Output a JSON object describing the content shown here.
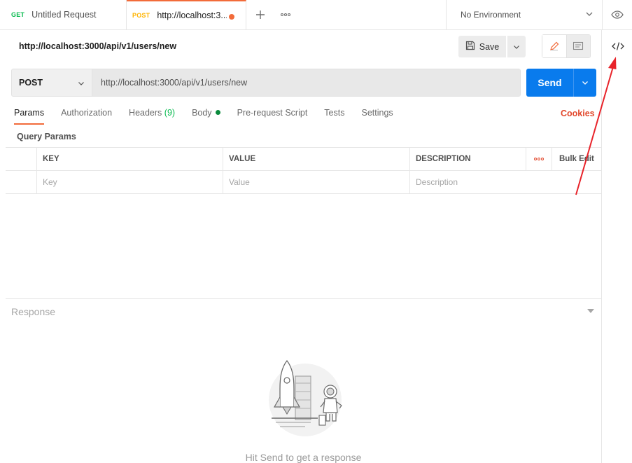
{
  "tabs": [
    {
      "method": "GET",
      "title": "Untitled Request"
    },
    {
      "method": "POST",
      "title": "http://localhost:3..."
    }
  ],
  "environment": {
    "selected": "No Environment"
  },
  "request": {
    "name": "http://localhost:3000/api/v1/users/new",
    "save_label": "Save",
    "method": "POST",
    "url": "http://localhost:3000/api/v1/users/new",
    "send_label": "Send"
  },
  "request_tabs": {
    "params": "Params",
    "authorization": "Authorization",
    "headers": "Headers",
    "headers_count": "(9)",
    "body": "Body",
    "prerequest": "Pre-request Script",
    "tests": "Tests",
    "settings": "Settings"
  },
  "cookies_label": "Cookies",
  "query_params": {
    "title": "Query Params",
    "columns": {
      "key": "KEY",
      "value": "VALUE",
      "description": "DESCRIPTION"
    },
    "bulk_edit_label": "Bulk Edit",
    "placeholders": {
      "key": "Key",
      "value": "Value",
      "description": "Description"
    }
  },
  "response": {
    "title": "Response",
    "empty_message": "Hit Send to get a response"
  },
  "colors": {
    "accent": "#f26b3a",
    "send_blue": "#097bed",
    "annotation_red": "#e8232a",
    "get_green": "#0cbb52",
    "post_yellow": "#ffb400"
  }
}
